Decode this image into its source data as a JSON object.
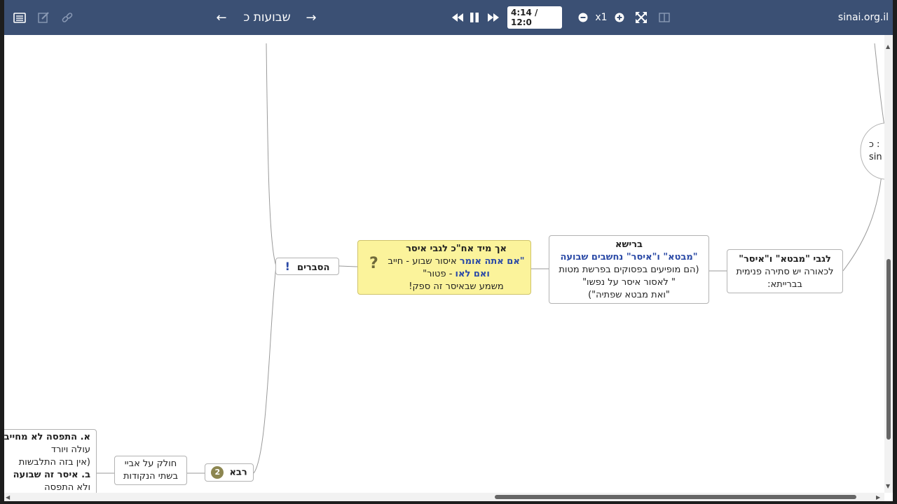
{
  "toolbar": {
    "title": "שבועות כ",
    "prev_arrow": "←",
    "next_arrow": "→",
    "time": "4:14 / 12:0",
    "speed": "x1",
    "site": "sinai.org.il",
    "icons": [
      "list-icon",
      "edit-icon",
      "link-icon",
      "rewind-icon",
      "pause-icon",
      "fast-forward-icon",
      "zoom-out-icon",
      "zoom-in-icon",
      "fullscreen-icon",
      "split-view-icon"
    ]
  },
  "map": {
    "node_lagabei": {
      "title": "לגבי \"מבטא\" ו\"איסר\"",
      "line1": "לכאורה יש סתירה פנימית",
      "line2": "בברייתא:"
    },
    "node_reisha": {
      "title": "ברישא",
      "line1": "\"מבטא\" ו\"איסר\" נחשבים שבועה",
      "line2": "(הם מופיעים בפסוקים בפרשת מטות",
      "line3": "\" לאסור איסר על נפשו\"",
      "line4": "\"ואת מבטא שפתיה\")"
    },
    "node_ach": {
      "title": "אך מיד אח\"כ לגבי איסר",
      "line1_blue": "\"אם אתה אומר",
      "line1_rest": " איסור שבוע - חייב",
      "line2_blue": "ואם לאו",
      "line2_rest": " - פטור\"",
      "line3": "משמע שבאיסר זה ספק!",
      "icon_text": "?"
    },
    "node_hesberim": {
      "label": "הסברים",
      "icon_text": "!"
    },
    "node_rava": {
      "label": "רבא",
      "badge": "2"
    },
    "node_holek": {
      "line1": "חולק על אביי",
      "line2": "בשתי הנקודות"
    },
    "node_left": {
      "line1": "א. התפסה לא מחייבת",
      "line2": "עולה ויורד",
      "line3": "(אין בזה התלבשות",
      "line4": "ב. איסר זה שבועה",
      "line5": "ולא התפסה"
    },
    "node_partial": {
      "line1": "כ :",
      "line2": "sin"
    }
  },
  "colors": {
    "toolbar_bg": "#3b5074",
    "yellow_node": "#fbf39b",
    "blue_text": "#2b4aa6"
  }
}
